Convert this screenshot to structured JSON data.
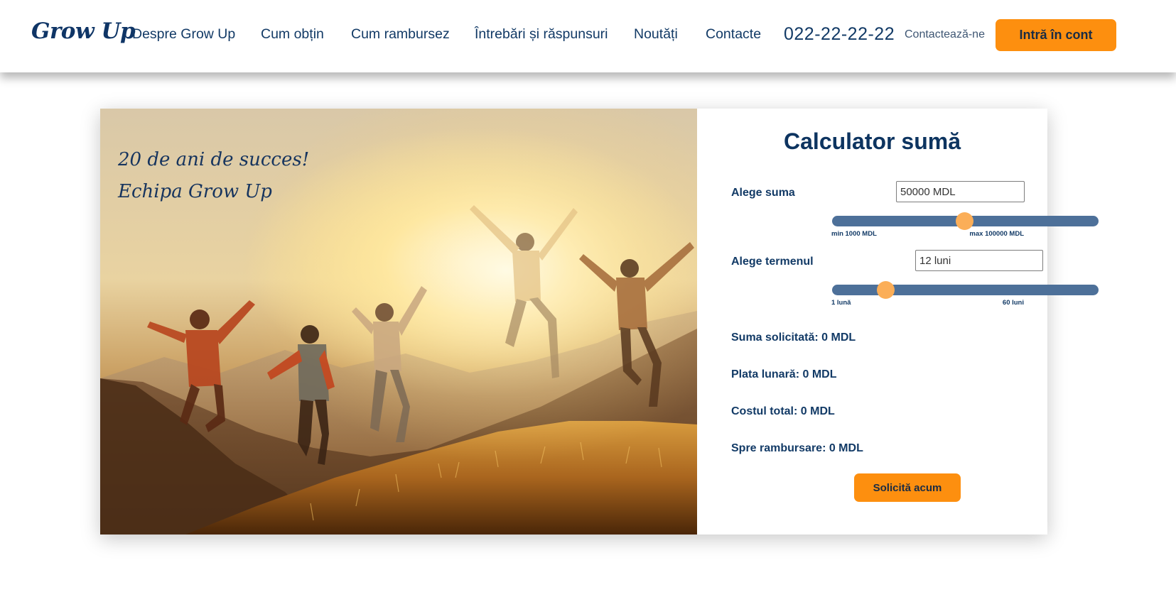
{
  "header": {
    "logo": "Grow Up",
    "nav": [
      "Despre Grow Up",
      "Cum obțin",
      "Cum rambursez",
      "Întrebări și răspunsuri",
      "Noutăți",
      "Contacte"
    ],
    "phone": "022-22-22-22",
    "contact_label": "Contactează-ne",
    "login_label": "Intră în cont"
  },
  "hero": {
    "caption_line1": "20 de ani de succes!",
    "caption_line2": "Echipa Grow Up"
  },
  "calculator": {
    "title": "Calculator sumă",
    "amount": {
      "label": "Alege suma",
      "value": "50000 MDL",
      "min_label": "min 1000 MDL",
      "max_label": "max 100000 MDL",
      "slider_fraction": 0.495
    },
    "term": {
      "label": "Alege termenul",
      "value": "12 luni",
      "min_label": "1 lună",
      "max_label": "60 luni",
      "slider_fraction": 0.2
    },
    "results": {
      "requested": "Suma solicitată: 0 MDL",
      "monthly": "Plata lunară: 0 MDL",
      "total_cost": "Costul total: 0 MDL",
      "to_repay": "Spre rambursare: 0 MDL"
    },
    "apply_label": "Solicită acum"
  },
  "colors": {
    "accent": "#fd8f0f",
    "navy": "#123a66",
    "slider_track": "#4d7099",
    "slider_thumb": "#fbae58"
  }
}
